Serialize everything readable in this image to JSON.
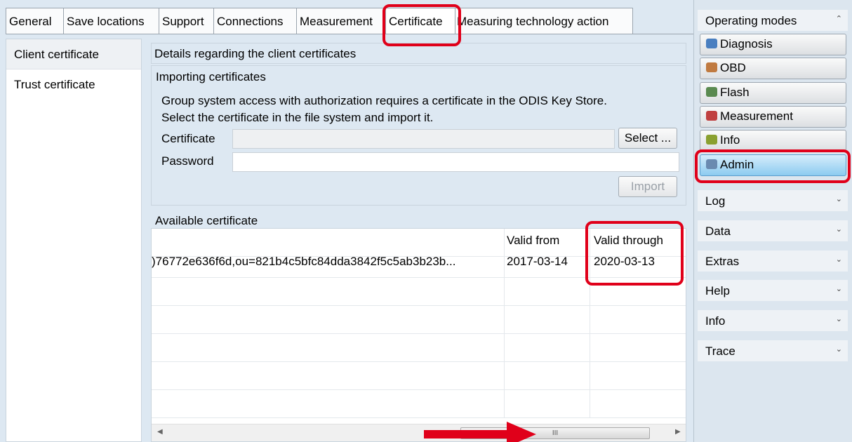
{
  "tabs": [
    {
      "label": "General"
    },
    {
      "label": "Save locations"
    },
    {
      "label": "Support"
    },
    {
      "label": "Connections"
    },
    {
      "label": "Measurement"
    },
    {
      "label": "Certificate"
    },
    {
      "label": "Measuring technology action"
    }
  ],
  "active_tab": "Certificate",
  "left_list": {
    "items": [
      {
        "label": "Client certificate"
      },
      {
        "label": "Trust certificate"
      }
    ]
  },
  "main": {
    "header": "Details regarding the client certificates",
    "import_group": {
      "title": "Importing certificates",
      "description_line1": "Group system access with authorization requires a certificate in the ODIS Key Store.",
      "description_line2": "Select the certificate in the file system and import it.",
      "certificate_label": "Certificate",
      "certificate_value": "",
      "password_label": "Password",
      "password_value": "",
      "select_button": "Select ...",
      "import_button": "Import"
    },
    "available": {
      "title": "Available certificate",
      "columns": {
        "subject": "",
        "valid_from": "Valid from",
        "valid_through": "Valid through"
      },
      "rows": [
        {
          "subject": ")76772e636f6d,ou=821b4c5bfc84dda3842f5c5ab3b23b...",
          "valid_from": "2017-03-14",
          "valid_through": "2020-03-13"
        }
      ],
      "scrollbar_grip": "III"
    }
  },
  "sidebar": {
    "operating_modes": {
      "title": "Operating modes",
      "buttons": [
        {
          "label": "Diagnosis",
          "icon": "diagnosis-icon",
          "color": "#4a7fc0"
        },
        {
          "label": "OBD",
          "icon": "obd-icon",
          "color": "#c07a40"
        },
        {
          "label": "Flash",
          "icon": "flash-icon",
          "color": "#5a8a50"
        },
        {
          "label": "Measurement",
          "icon": "measurement-icon",
          "color": "#c04040"
        },
        {
          "label": "Info",
          "icon": "info-icon",
          "color": "#8aa030"
        },
        {
          "label": "Admin",
          "icon": "admin-icon",
          "color": "#6a8ab0"
        }
      ],
      "active": "Admin"
    },
    "sections": [
      {
        "label": "Log"
      },
      {
        "label": "Data"
      },
      {
        "label": "Extras"
      },
      {
        "label": "Help"
      },
      {
        "label": "Info"
      },
      {
        "label": "Trace"
      }
    ]
  },
  "colors": {
    "highlight": "#e0001a",
    "active_button": "#8ccbf0"
  }
}
